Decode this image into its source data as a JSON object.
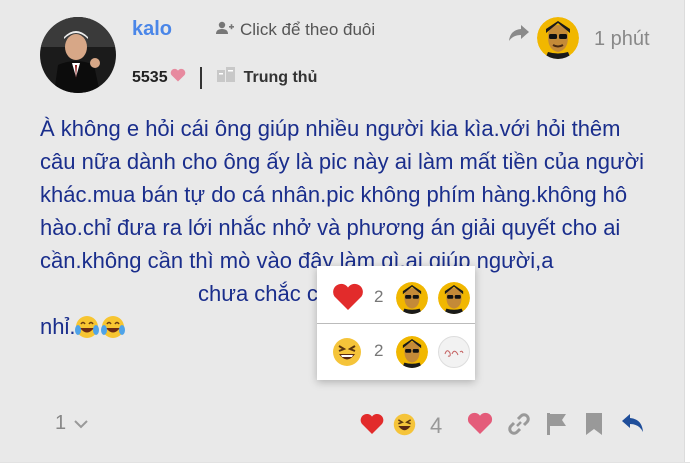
{
  "post": {
    "username": "kalo",
    "follow_label": "Click để theo đuôi",
    "likes_received": "5535",
    "badge": "Trung thủ",
    "time": "1 phút",
    "content": "À không e hỏi cái ông giúp nhiều người kia kìa.với hỏi thêm câu nữa dành cho ông ấy là pic này ai làm mất tiền của người khác.mua bán tự do cá nhân.pic không phím hàng.không hô hào.chỉ đưa ra lới nhắc nhở và phương án giải quyết cho ai cần.không cần thì mò vào đây làm gì.ai giúp người,a",
    "content_tail": "chưa chắc cô",
    "content_last": "nhỉ."
  },
  "reactions_popup": {
    "rows": [
      {
        "emoji": "heart",
        "count": "2",
        "avatars": [
          "avatar-user",
          "avatar-user"
        ]
      },
      {
        "emoji": "laughing",
        "count": "2",
        "avatars": [
          "avatar-user",
          "ga"
        ]
      }
    ]
  },
  "footer": {
    "reply_count": "1",
    "reaction_total": "4"
  },
  "icons": {
    "follow": "user-plus-icon",
    "reply_to": "share-arrow-icon",
    "like": "heart-icon",
    "link": "link-icon",
    "flag": "flag-icon",
    "bookmark": "bookmark-icon",
    "reply": "reply-icon"
  },
  "colors": {
    "background": "#e9e9e9",
    "username": "#4a86e8",
    "content_text": "#1a2e8c",
    "heart": "#e45c7a",
    "reply_blue": "#1f4e9a"
  }
}
